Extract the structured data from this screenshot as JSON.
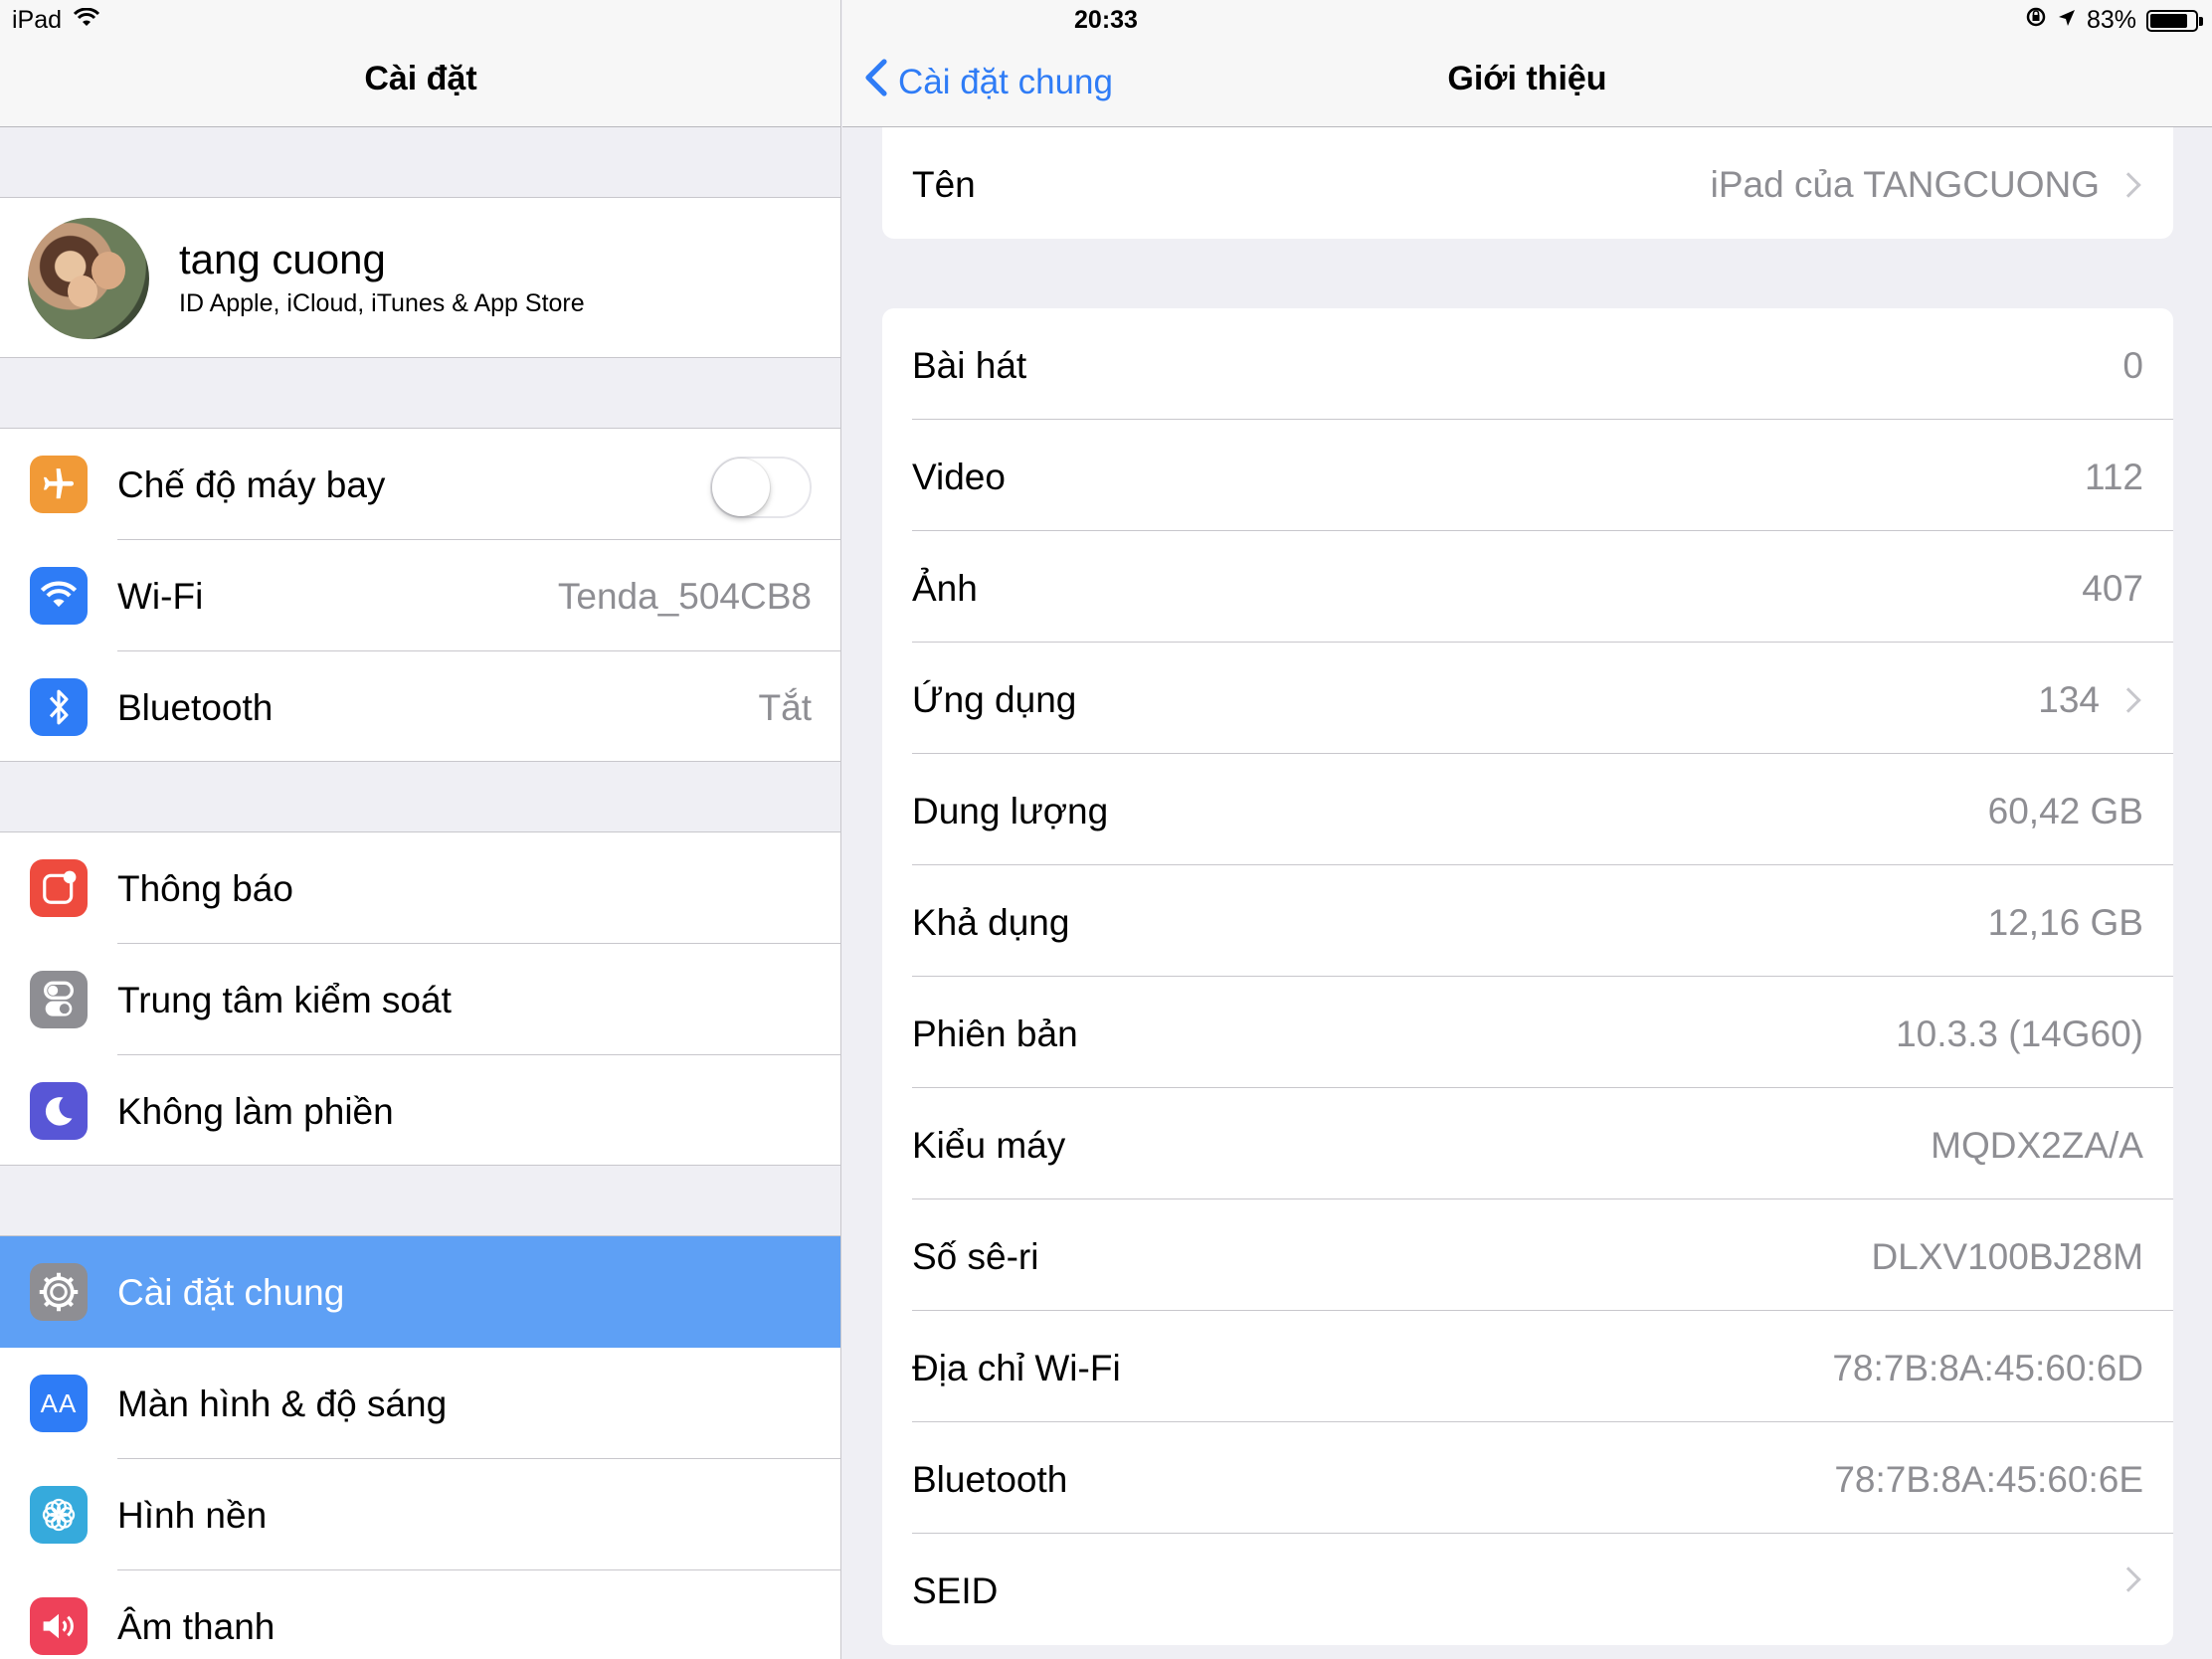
{
  "status": {
    "device": "iPad",
    "time": "20:33",
    "battery": "83%",
    "battery_level": 0.83
  },
  "master": {
    "title": "Cài đặt",
    "profile": {
      "name": "tang cuong",
      "subtitle": "ID Apple, iCloud, iTunes & App Store"
    },
    "group1": [
      {
        "label": "Chế độ máy bay",
        "value": "",
        "icon": "airplane-icon",
        "color": "#f19a37",
        "toggle": false
      },
      {
        "label": "Wi-Fi",
        "value": "Tenda_504CB8",
        "icon": "wifi-icon",
        "color": "#2e7cf6"
      },
      {
        "label": "Bluetooth",
        "value": "Tắt",
        "icon": "bluetooth-icon",
        "color": "#2e7cf6"
      }
    ],
    "group2": [
      {
        "label": "Thông báo",
        "icon": "notifications-icon",
        "color": "#ee4b3e"
      },
      {
        "label": "Trung tâm kiểm soát",
        "icon": "control-center-icon",
        "color": "#8e8e93"
      },
      {
        "label": "Không làm phiền",
        "icon": "moon-icon",
        "color": "#5856d6"
      }
    ],
    "group3": [
      {
        "label": "Cài đặt chung",
        "icon": "gear-icon",
        "color": "#8e8e93",
        "selected": true
      },
      {
        "label": "Màn hình & độ sáng",
        "icon": "display-icon",
        "color": "#2e7cf6",
        "icon_text": "AA"
      },
      {
        "label": "Hình nền",
        "icon": "wallpaper-icon",
        "color": "#36aadc"
      },
      {
        "label": "Âm thanh",
        "icon": "sound-icon",
        "color": "#ee4159"
      }
    ]
  },
  "detail": {
    "back_label": "Cài đặt chung",
    "title": "Giới thiệu",
    "name_row": {
      "label": "Tên",
      "value": "iPad của TANGCUONG"
    },
    "rows": [
      {
        "label": "Bài hát",
        "value": "0"
      },
      {
        "label": "Video",
        "value": "112"
      },
      {
        "label": "Ảnh",
        "value": "407"
      },
      {
        "label": "Ứng dụng",
        "value": "134",
        "chevron": true
      },
      {
        "label": "Dung lượng",
        "value": "60,42 GB"
      },
      {
        "label": "Khả dụng",
        "value": "12,16 GB"
      },
      {
        "label": "Phiên bản",
        "value": "10.3.3 (14G60)"
      },
      {
        "label": "Kiểu máy",
        "value": "MQDX2ZA/A"
      },
      {
        "label": "Số sê-ri",
        "value": "DLXV100BJ28M"
      },
      {
        "label": "Địa chỉ Wi-Fi",
        "value": "78:7B:8A:45:60:6D"
      },
      {
        "label": "Bluetooth",
        "value": "78:7B:8A:45:60:6E"
      },
      {
        "label": "SEID",
        "value": "",
        "chevron": true
      }
    ]
  }
}
